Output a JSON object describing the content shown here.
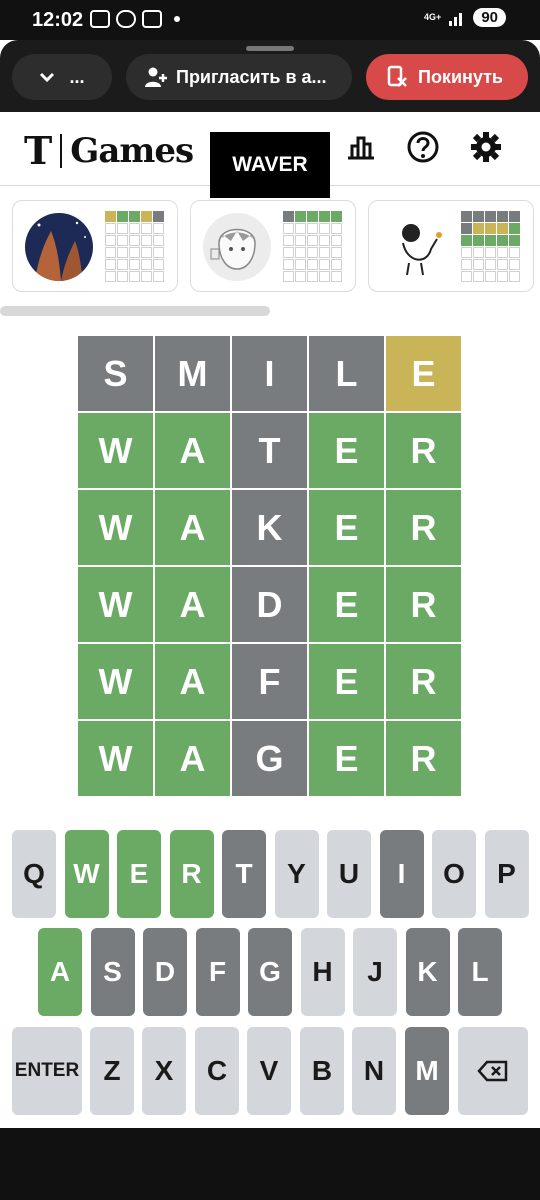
{
  "status_bar": {
    "time": "12:02",
    "network": "4G+",
    "battery": "90"
  },
  "app_bar": {
    "collapse_label": "...",
    "invite_label": "Пригласить в а...",
    "leave_label": "Покинуть",
    "leave_color": "#d84a4a"
  },
  "header": {
    "logo_t": "T",
    "logo_games": "Games"
  },
  "tooltip": {
    "word": "WAVER"
  },
  "players": [
    {
      "avatar": "space-nebula-avatar",
      "mini": [
        "y",
        "g",
        "g",
        "y",
        "x",
        "e",
        "e",
        "e",
        "e",
        "e",
        "e",
        "e",
        "e",
        "e",
        "e",
        "e",
        "e",
        "e",
        "e",
        "e",
        "e",
        "e",
        "e",
        "e",
        "e",
        "e",
        "e",
        "e",
        "e",
        "e"
      ]
    },
    {
      "avatar": "anime-sketch-avatar",
      "mini": [
        "x",
        "g",
        "g",
        "g",
        "g",
        "e",
        "e",
        "e",
        "e",
        "e",
        "e",
        "e",
        "e",
        "e",
        "e",
        "e",
        "e",
        "e",
        "e",
        "e",
        "e",
        "e",
        "e",
        "e",
        "e",
        "e",
        "e",
        "e",
        "e",
        "e"
      ]
    },
    {
      "avatar": "cartoon-character-avatar",
      "mini": [
        "x",
        "x",
        "x",
        "x",
        "x",
        "x",
        "y",
        "y",
        "y",
        "g",
        "g",
        "g",
        "g",
        "g",
        "g",
        "e",
        "e",
        "e",
        "e",
        "e",
        "e",
        "e",
        "e",
        "e",
        "e",
        "e",
        "e",
        "e",
        "e",
        "e"
      ]
    }
  ],
  "board": [
    [
      {
        "l": "S",
        "s": "x"
      },
      {
        "l": "M",
        "s": "x"
      },
      {
        "l": "I",
        "s": "x"
      },
      {
        "l": "L",
        "s": "x"
      },
      {
        "l": "E",
        "s": "y"
      }
    ],
    [
      {
        "l": "W",
        "s": "g"
      },
      {
        "l": "A",
        "s": "g"
      },
      {
        "l": "T",
        "s": "x"
      },
      {
        "l": "E",
        "s": "g"
      },
      {
        "l": "R",
        "s": "g"
      }
    ],
    [
      {
        "l": "W",
        "s": "g"
      },
      {
        "l": "A",
        "s": "g"
      },
      {
        "l": "K",
        "s": "x"
      },
      {
        "l": "E",
        "s": "g"
      },
      {
        "l": "R",
        "s": "g"
      }
    ],
    [
      {
        "l": "W",
        "s": "g"
      },
      {
        "l": "A",
        "s": "g"
      },
      {
        "l": "D",
        "s": "x"
      },
      {
        "l": "E",
        "s": "g"
      },
      {
        "l": "R",
        "s": "g"
      }
    ],
    [
      {
        "l": "W",
        "s": "g"
      },
      {
        "l": "A",
        "s": "g"
      },
      {
        "l": "F",
        "s": "x"
      },
      {
        "l": "E",
        "s": "g"
      },
      {
        "l": "R",
        "s": "g"
      }
    ],
    [
      {
        "l": "W",
        "s": "g"
      },
      {
        "l": "A",
        "s": "g"
      },
      {
        "l": "G",
        "s": "x"
      },
      {
        "l": "E",
        "s": "g"
      },
      {
        "l": "R",
        "s": "g"
      }
    ]
  ],
  "keyboard": {
    "row1": [
      {
        "k": "Q",
        "s": ""
      },
      {
        "k": "W",
        "s": "g"
      },
      {
        "k": "E",
        "s": "g"
      },
      {
        "k": "R",
        "s": "g"
      },
      {
        "k": "T",
        "s": "x"
      },
      {
        "k": "Y",
        "s": ""
      },
      {
        "k": "U",
        "s": ""
      },
      {
        "k": "I",
        "s": "x"
      },
      {
        "k": "O",
        "s": ""
      },
      {
        "k": "P",
        "s": ""
      }
    ],
    "row2": [
      {
        "k": "A",
        "s": "g"
      },
      {
        "k": "S",
        "s": "x"
      },
      {
        "k": "D",
        "s": "x"
      },
      {
        "k": "F",
        "s": "x"
      },
      {
        "k": "G",
        "s": "x"
      },
      {
        "k": "H",
        "s": ""
      },
      {
        "k": "J",
        "s": ""
      },
      {
        "k": "K",
        "s": "x"
      },
      {
        "k": "L",
        "s": "x"
      }
    ],
    "row3": [
      {
        "k": "ENTER",
        "s": "",
        "enter": true
      },
      {
        "k": "Z",
        "s": ""
      },
      {
        "k": "X",
        "s": ""
      },
      {
        "k": "C",
        "s": ""
      },
      {
        "k": "V",
        "s": ""
      },
      {
        "k": "B",
        "s": ""
      },
      {
        "k": "N",
        "s": ""
      },
      {
        "k": "M",
        "s": "x"
      },
      {
        "k": "backspace-icon",
        "s": "",
        "back": true
      }
    ]
  },
  "colors": {
    "correct": "#6aaa64",
    "present": "#c9b458",
    "absent": "#787c7e",
    "key_default": "#d3d6da"
  }
}
